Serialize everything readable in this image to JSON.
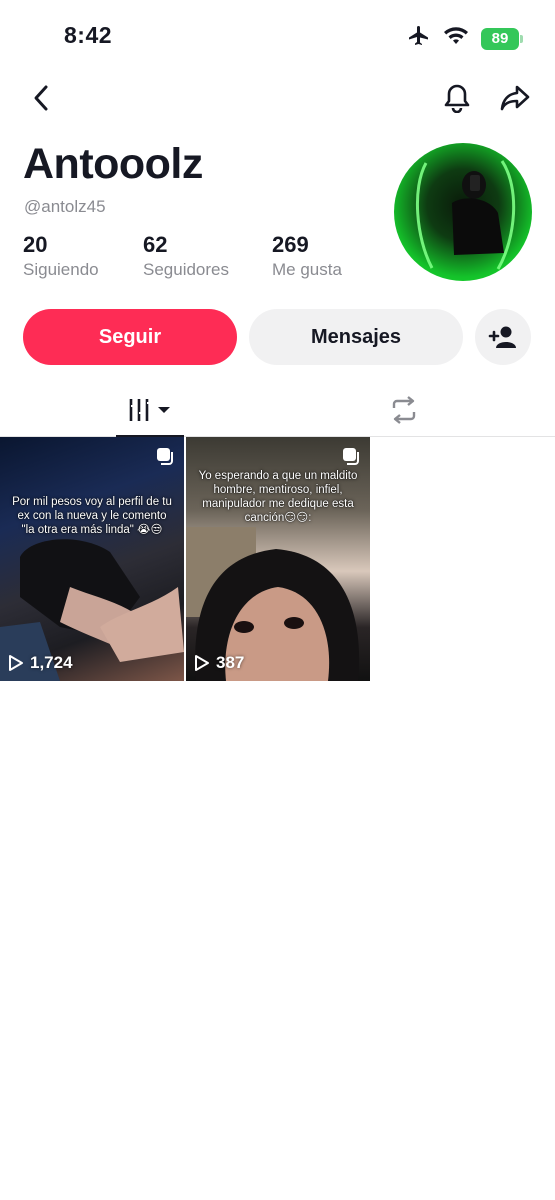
{
  "status_bar": {
    "time": "8:42",
    "battery": "89",
    "icons": [
      "airplane-icon",
      "wifi-icon",
      "battery-icon"
    ]
  },
  "nav": {
    "icons": [
      "back-chevron-icon",
      "bell-icon",
      "share-icon"
    ]
  },
  "profile": {
    "name": "Antooolz",
    "handle": "@antolz45",
    "stats": [
      {
        "value": "20",
        "label": "Siguiendo"
      },
      {
        "value": "62",
        "label": "Seguidores"
      },
      {
        "value": "269",
        "label": "Me gusta"
      }
    ]
  },
  "actions": {
    "follow_label": "Seguir",
    "message_label": "Mensajes",
    "add_friend_icon": "add-person-icon"
  },
  "tabs": {
    "items": [
      {
        "name": "videos-grid-tab",
        "icon": "grid-bars-icon",
        "active": true
      },
      {
        "name": "reposts-tab",
        "icon": "repost-icon",
        "active": false
      }
    ]
  },
  "videos": [
    {
      "caption": "Por mil pesos voy al perfil de tu ex con la nueva y le comento \"la otra era más linda\" 😭😒",
      "views": "1,724"
    },
    {
      "caption": "Yo esperando a que un maldito hombre, mentiroso, infiel, manipulador me dedique esta canción😏😏:",
      "views": "387"
    }
  ],
  "colors": {
    "accent": "#fe2c55",
    "secondary_button": "#f1f1f2",
    "muted_text": "#8a8b91",
    "battery": "#34c759"
  }
}
